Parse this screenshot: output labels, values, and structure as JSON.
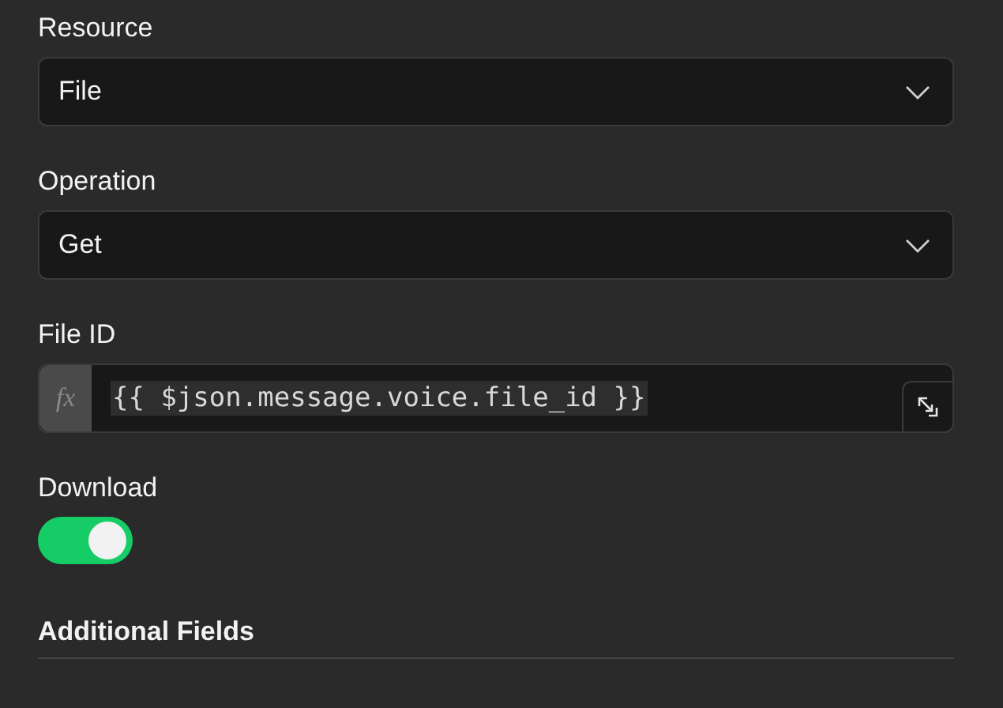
{
  "fields": [
    {
      "kind": "select",
      "label": "Resource",
      "value": "File"
    },
    {
      "kind": "select",
      "label": "Operation",
      "value": "Get"
    },
    {
      "kind": "expression",
      "label": "File ID",
      "prefix": "fx",
      "value": "{{ $json.message.voice.file_id }}"
    },
    {
      "kind": "toggle",
      "label": "Download",
      "on": true
    }
  ],
  "section": {
    "title": "Additional Fields"
  }
}
